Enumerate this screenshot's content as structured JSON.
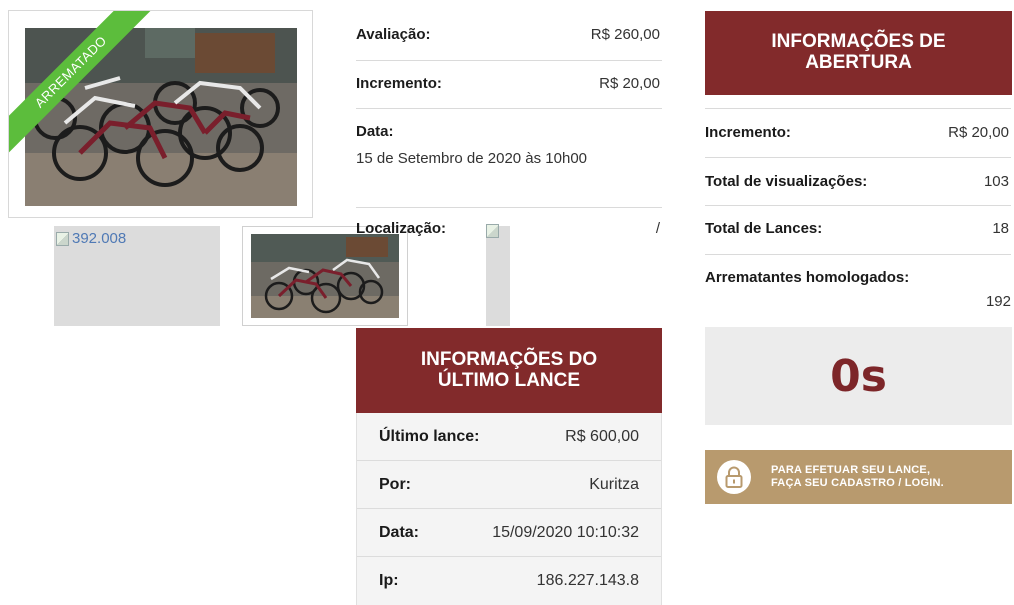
{
  "main_image": {
    "badge": "ARREMATADO"
  },
  "thumbnails": [
    {
      "alt": "392.008"
    }
  ],
  "lot_info": {
    "evaluation_label": "Avaliação:",
    "evaluation_value": "R$ 260,00",
    "increment_label": "Incremento:",
    "increment_value": "R$ 20,00",
    "date_label": "Data:",
    "date_value": "15 de Setembro de 2020 às 10h00",
    "location_label": "Localização:",
    "location_value": "/"
  },
  "last_bid": {
    "title": "INFORMAÇÕES DO ÚLTIMO LANCE",
    "rows": [
      {
        "label": "Último lance:",
        "value": "R$ 600,00"
      },
      {
        "label": "Por:",
        "value": "Kuritza"
      },
      {
        "label": "Data:",
        "value": "15/09/2020 10:10:32"
      },
      {
        "label": "Ip:",
        "value": "186.227.143.8"
      }
    ]
  },
  "opening_info": {
    "title": "INFORMAÇÕES DE ABERTURA",
    "increment_label": "Incremento:",
    "increment_value": "R$ 20,00",
    "views_label": "Total de visualizações:",
    "views_value": "103",
    "bids_label": "Total de Lances:",
    "bids_value": "18",
    "approved_label": "Arrematantes homologados:",
    "approved_value": "192"
  },
  "timer": {
    "value": "0s"
  },
  "login_cta": {
    "line1": "PARA EFETUAR SEU LANCE,",
    "line2": "FAÇA SEU CADASTRO / LOGIN."
  },
  "colors": {
    "accent": "#822a2b",
    "badge": "#5cbd3c",
    "cta": "#b89a6e",
    "timer_bg": "#ececec"
  }
}
